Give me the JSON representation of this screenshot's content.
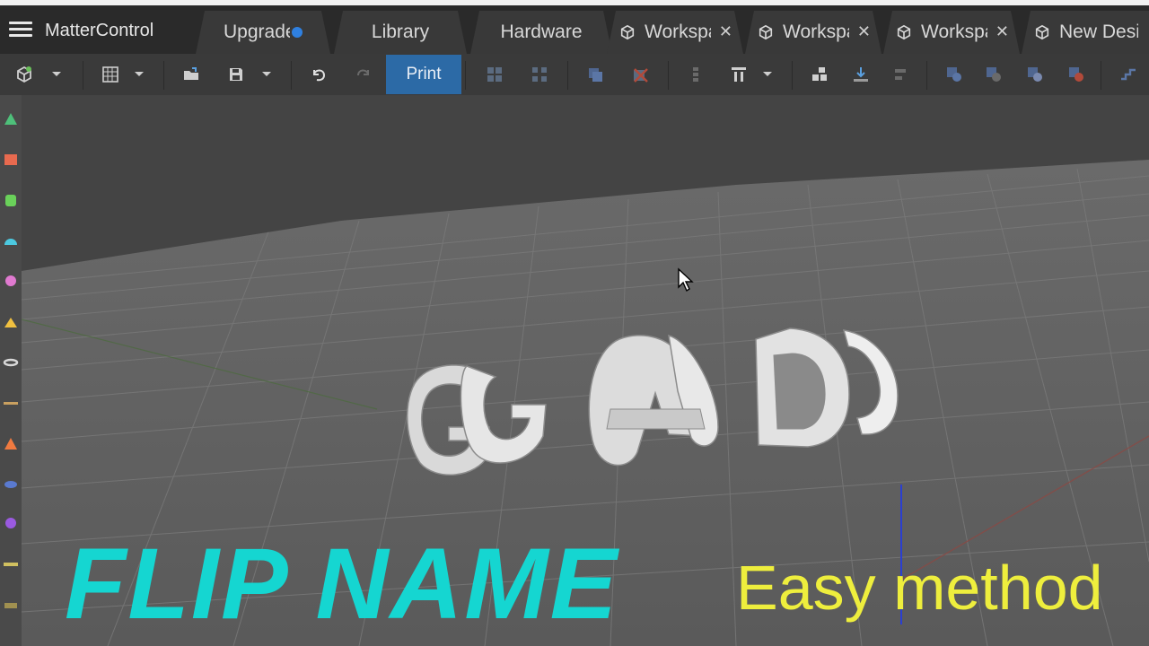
{
  "app": {
    "title": "MatterControl"
  },
  "tabs": [
    {
      "label": "Upgrade",
      "has_dot": true
    },
    {
      "label": "Library"
    },
    {
      "label": "Hardware"
    },
    {
      "label": "Workspace",
      "closable": true
    },
    {
      "label": "Workspace",
      "closable": true
    },
    {
      "label": "Workspace",
      "closable": true
    },
    {
      "label": "New Design",
      "closable": true
    }
  ],
  "tab_icon": "cube-icon",
  "toolbar": {
    "print_label": "Print"
  },
  "overlay": {
    "headline": "FLIP NAME",
    "subline": "Easy method"
  },
  "colors": {
    "accent": "#2c6aa6",
    "headline": "#15d6d1",
    "subline": "#eeee3d",
    "notify_dot": "#2f80e0"
  }
}
